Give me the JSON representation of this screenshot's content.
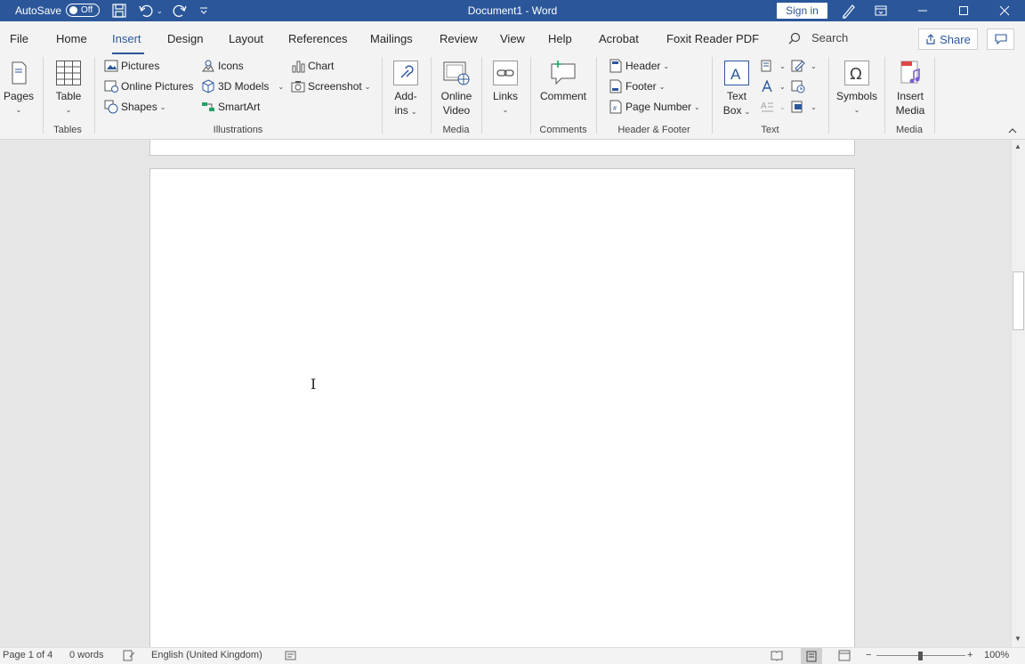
{
  "titlebar": {
    "autosave_label": "AutoSave",
    "autosave_state": "Off",
    "document_title": "Document1 - Word",
    "signin_label": "Sign in"
  },
  "tabs": [
    {
      "label": "File"
    },
    {
      "label": "Home"
    },
    {
      "label": "Insert",
      "active": true
    },
    {
      "label": "Design"
    },
    {
      "label": "Layout"
    },
    {
      "label": "References"
    },
    {
      "label": "Mailings"
    },
    {
      "label": "Review"
    },
    {
      "label": "View"
    },
    {
      "label": "Help"
    },
    {
      "label": "Acrobat"
    },
    {
      "label": "Foxit Reader PDF"
    }
  ],
  "search": {
    "label": "Search"
  },
  "share": {
    "label": "Share"
  },
  "ribbon": {
    "pages": {
      "label": "Pages"
    },
    "table": {
      "label": "Table"
    },
    "tables_group": "Tables",
    "pictures": "Pictures",
    "online_pictures": "Online Pictures",
    "shapes": "Shapes",
    "icons": "Icons",
    "models_3d": "3D Models",
    "smartart": "SmartArt",
    "chart": "Chart",
    "screenshot": "Screenshot",
    "illustrations_group": "Illustrations",
    "addins": {
      "line1": "Add-",
      "line2": "ins"
    },
    "online_video": {
      "line1": "Online",
      "line2": "Video"
    },
    "media_group": "Media",
    "links": {
      "label": "Links"
    },
    "comment": {
      "label": "Comment"
    },
    "comments_group": "Comments",
    "header": "Header",
    "footer": "Footer",
    "page_number": "Page Number",
    "header_footer_group": "Header & Footer",
    "text_box": {
      "line1": "Text",
      "line2": "Box"
    },
    "text_group": "Text",
    "symbols": {
      "label": "Symbols"
    },
    "insert_media": {
      "line1": "Insert",
      "line2": "Media"
    },
    "media_group2": "Media"
  },
  "statusbar": {
    "page": "Page 1 of 4",
    "words": "0 words",
    "language": "English (United Kingdom)",
    "zoom": "100%"
  },
  "colors": {
    "accent": "#2b579a",
    "ribbon_bg": "#f3f3f3",
    "canvas_bg": "#e6e6e6"
  }
}
